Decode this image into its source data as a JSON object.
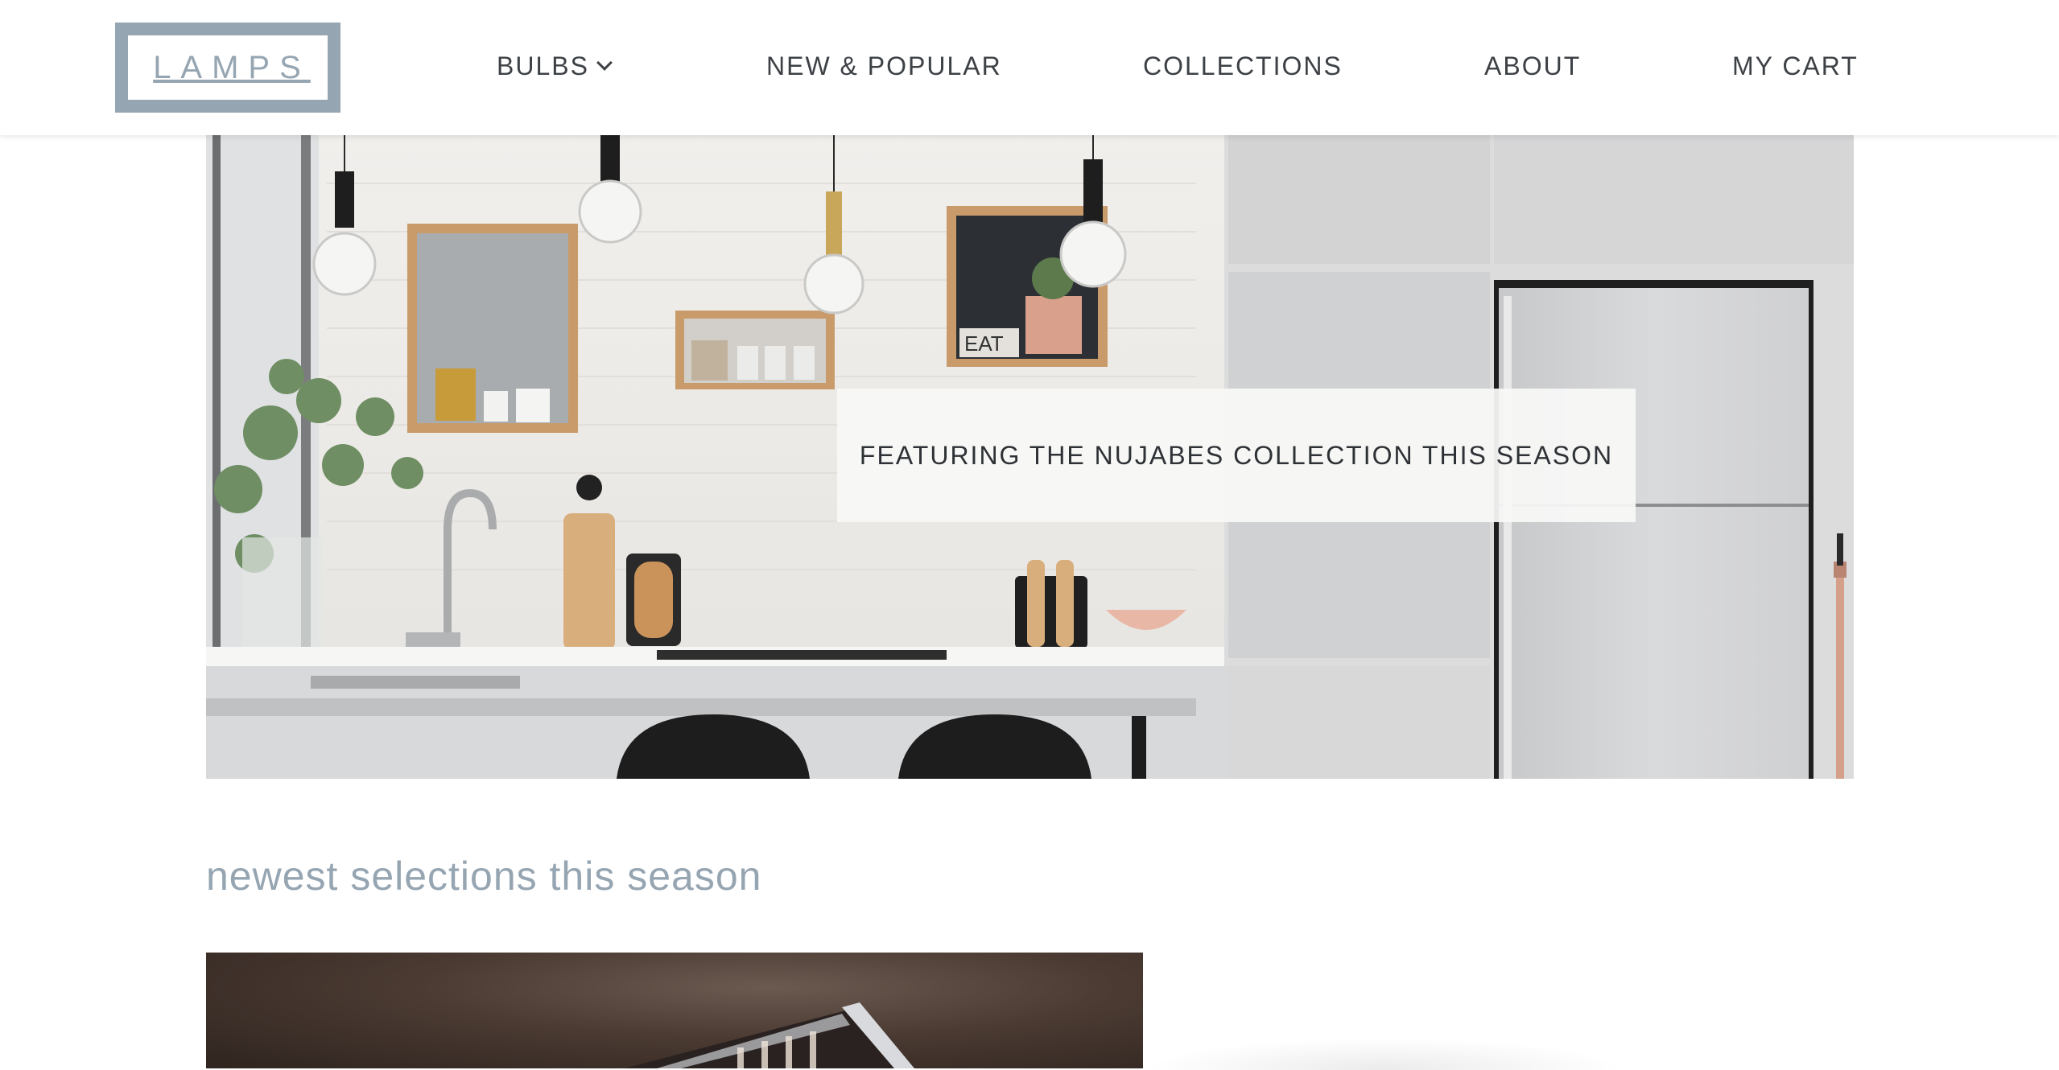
{
  "brand": {
    "logo_text": "LAMPS",
    "accent_color": "#96a5b2"
  },
  "nav": {
    "items": [
      {
        "label": "BULBS",
        "has_dropdown": true
      },
      {
        "label": "NEW & POPULAR"
      },
      {
        "label": "COLLECTIONS"
      },
      {
        "label": "ABOUT"
      },
      {
        "label": "MY CART"
      }
    ]
  },
  "hero": {
    "banner_text": "FEATURING THE NUJABES COLLECTION THIS SEASON",
    "jar_label": "EAT"
  },
  "section": {
    "title": "newest selections this season"
  }
}
